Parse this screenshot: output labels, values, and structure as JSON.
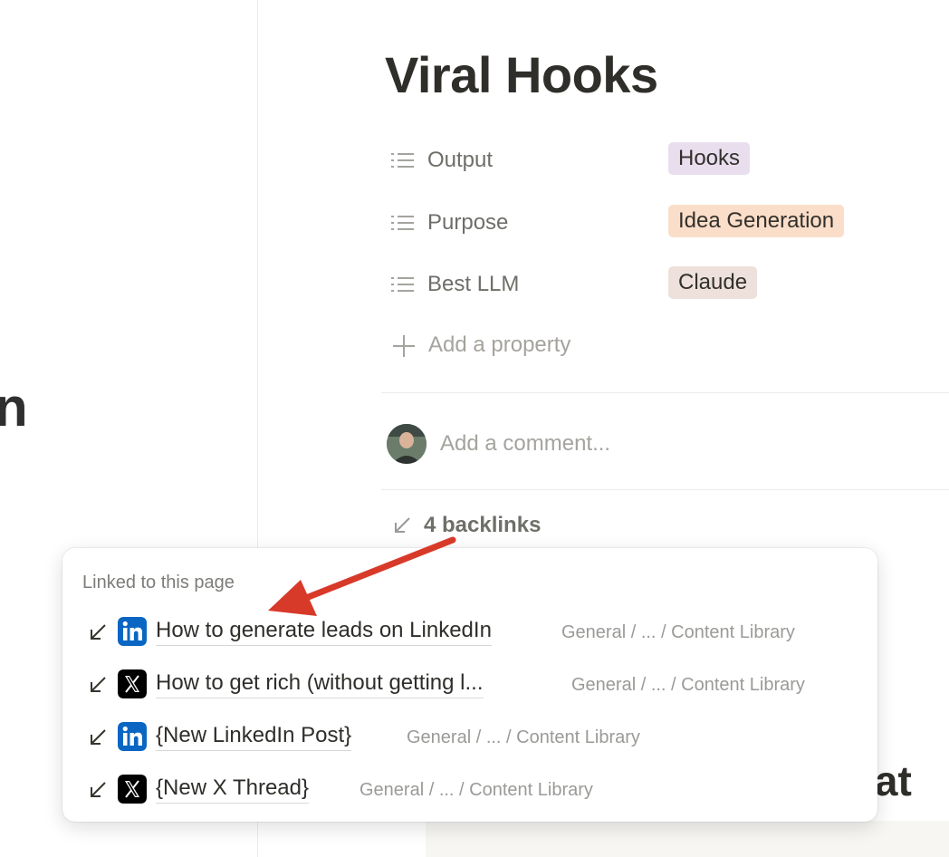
{
  "left_fragment_text": "n",
  "page": {
    "title": "Viral Hooks",
    "properties": [
      {
        "label": "Output",
        "value": "Hooks",
        "tag_color": "#e8deee",
        "icon": "list-icon"
      },
      {
        "label": "Purpose",
        "value": "Idea Generation",
        "tag_color": "#fadec9",
        "icon": "list-icon"
      },
      {
        "label": "Best LLM",
        "value": "Claude",
        "tag_color": "#eee0da",
        "icon": "list-icon"
      }
    ],
    "add_property_label": "Add a property",
    "comment_placeholder": "Add a comment...",
    "backlinks_label": "4 backlinks",
    "background_partial_text": "plat"
  },
  "popover": {
    "heading": "Linked to this page",
    "items": [
      {
        "title": "How to generate leads on LinkedIn",
        "path": "General / ... / Content Library",
        "icon": "linkedin-icon"
      },
      {
        "title": "How to get rich (without getting l...",
        "path": "General / ... / Content Library",
        "icon": "x-icon"
      },
      {
        "title": "{New LinkedIn Post}",
        "path": "General / ... / Content Library",
        "icon": "linkedin-icon"
      },
      {
        "title": "{New X Thread}",
        "path": "General / ... / Content Library",
        "icon": "x-icon"
      }
    ]
  },
  "colors": {
    "linkedin": "#0a66c2",
    "x": "#000000",
    "annotation_arrow": "#d83a2a"
  }
}
